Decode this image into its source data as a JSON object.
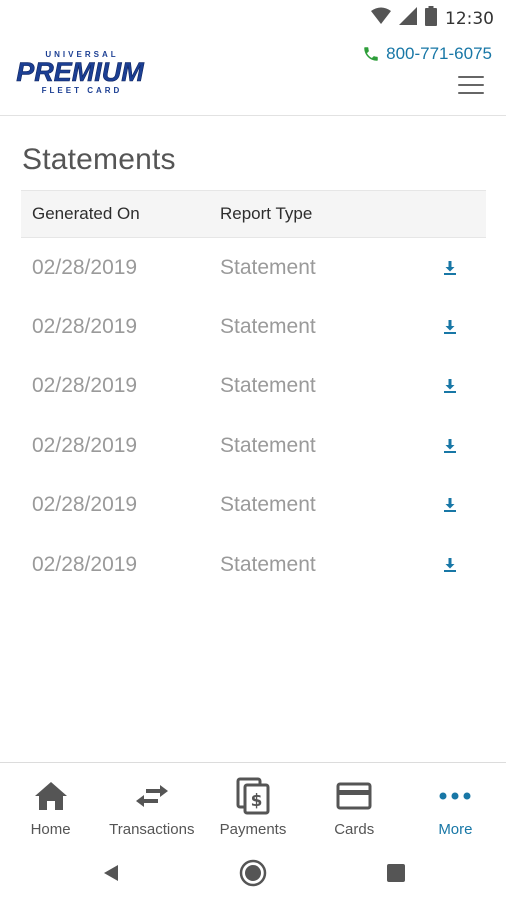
{
  "status_bar": {
    "time": "12:30"
  },
  "header": {
    "logo": {
      "top": "UNIVERSAL",
      "main": "PREMIUM",
      "bottom": "FLEET CARD"
    },
    "phone": "800-771-6075",
    "menu_icon": "hamburger-icon"
  },
  "page": {
    "title": "Statements"
  },
  "table": {
    "headers": {
      "generated_on": "Generated On",
      "report_type": "Report Type"
    },
    "rows": [
      {
        "date": "02/28/2019",
        "type": "Statement"
      },
      {
        "date": "02/28/2019",
        "type": "Statement"
      },
      {
        "date": "02/28/2019",
        "type": "Statement"
      },
      {
        "date": "02/28/2019",
        "type": "Statement"
      },
      {
        "date": "02/28/2019",
        "type": "Statement"
      },
      {
        "date": "02/28/2019",
        "type": "Statement"
      }
    ]
  },
  "bottom_nav": {
    "items": [
      {
        "label": "Home",
        "icon": "home-icon"
      },
      {
        "label": "Transactions",
        "icon": "swap-arrows-icon"
      },
      {
        "label": "Payments",
        "icon": "payments-icon"
      },
      {
        "label": "Cards",
        "icon": "card-icon"
      },
      {
        "label": "More",
        "icon": "more-dots-icon"
      }
    ],
    "active": "More"
  },
  "colors": {
    "accent": "#1877a6",
    "phone_icon": "#2e9e3a",
    "logo_blue": "#1c3f93",
    "text_muted": "#9a9a9a"
  }
}
